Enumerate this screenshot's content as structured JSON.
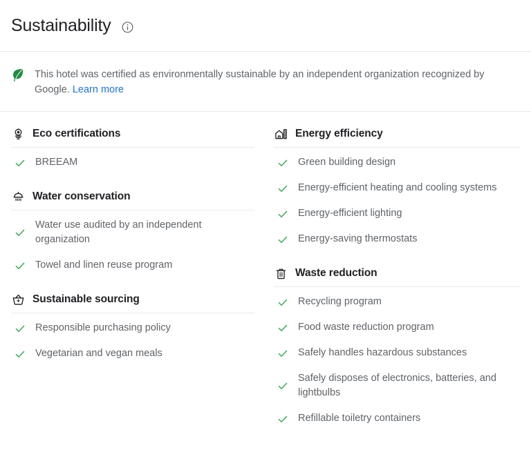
{
  "header": {
    "title": "Sustainability",
    "info_icon": "info-circle-icon"
  },
  "banner": {
    "icon": "leaf-icon",
    "text": "This hotel was certified as environmentally sustainable by an independent organization recognized by Google.",
    "link_label": "Learn more",
    "link_color": "#1a73e8"
  },
  "colors": {
    "check": "#34a853",
    "leaf": "#1e8e3e",
    "text_primary": "#202124",
    "text_secondary": "#5f6368",
    "divider": "#e8eaed"
  },
  "columns": {
    "left": [
      {
        "icon": "award-medal-icon",
        "title": "Eco certifications",
        "items": [
          "BREEAM"
        ]
      },
      {
        "icon": "shower-head-icon",
        "title": "Water conservation",
        "items": [
          "Water use audited by an independent organization",
          "Towel and linen reuse program"
        ]
      },
      {
        "icon": "shopping-basket-icon",
        "title": "Sustainable sourcing",
        "items": [
          "Responsible purchasing policy",
          "Vegetarian and vegan meals"
        ]
      }
    ],
    "right": [
      {
        "icon": "building-energy-icon",
        "title": "Energy efficiency",
        "items": [
          "Green building design",
          "Energy-efficient heating and cooling systems",
          "Energy-efficient lighting",
          "Energy-saving thermostats"
        ]
      },
      {
        "icon": "trash-bin-icon",
        "title": "Waste reduction",
        "items": [
          "Recycling program",
          "Food waste reduction program",
          "Safely handles hazardous substances",
          "Safely disposes of electronics, batteries, and lightbulbs",
          "Refillable toiletry containers"
        ]
      }
    ]
  }
}
